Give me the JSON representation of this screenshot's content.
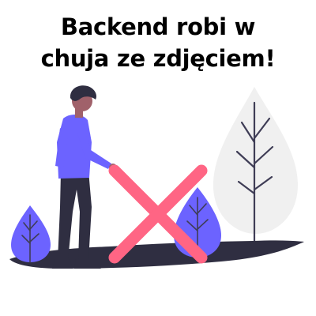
{
  "title": {
    "line1": "Backend robi w",
    "line2": "chuja ze zdjęciem!"
  },
  "colors": {
    "background": "#ffffff",
    "ground": "#2f2e41",
    "tree_blue": "#6c63ff",
    "tree_gray": "#f0f0f0",
    "tree_trunk": "#3f3d56",
    "cross": "#ff6584",
    "shirt": "#6c63ff",
    "pants": "#2f2e41",
    "skin": "#a0616a",
    "hair": "#2f2e41"
  }
}
